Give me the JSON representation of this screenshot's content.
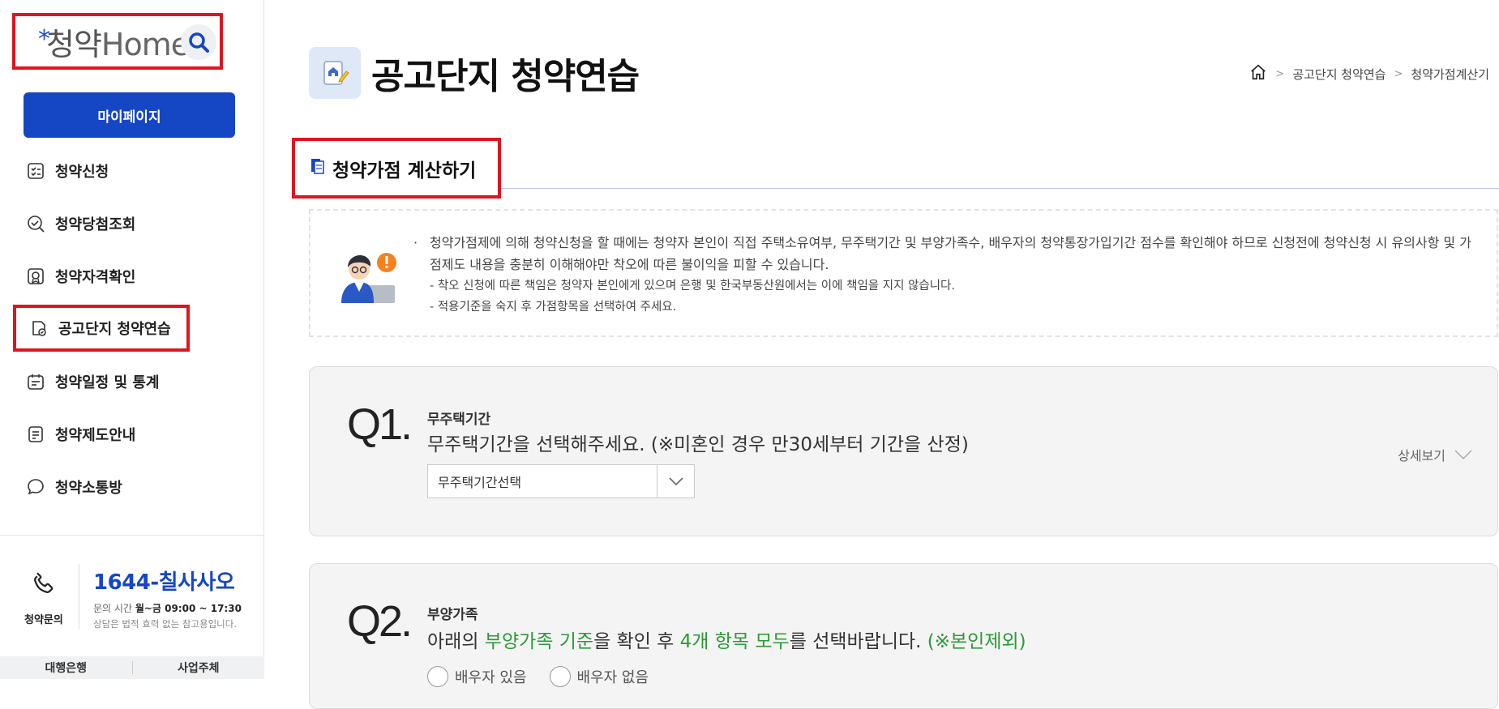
{
  "sidebar": {
    "logo_star": "*",
    "logo_text_ko": "청약",
    "logo_text_en": "Home",
    "mypage_label": "마이페이지",
    "items": [
      {
        "label": "청약신청",
        "icon": "checklist-icon"
      },
      {
        "label": "청약당첨조회",
        "icon": "search-check-icon"
      },
      {
        "label": "청약자격확인",
        "icon": "certificate-icon"
      },
      {
        "label": "공고단지 청약연습",
        "icon": "practice-icon"
      },
      {
        "label": "청약일정 및 통계",
        "icon": "calendar-icon"
      },
      {
        "label": "청약제도안내",
        "icon": "document-icon"
      },
      {
        "label": "청약소통방",
        "icon": "chat-bubble-icon"
      }
    ],
    "contact": {
      "label": "청약문의",
      "number": "1644-칠사사오",
      "hours_prefix": "문의 시간",
      "hours_value": "월~금 09:00 ~ 17:30",
      "note": "상담은 법적 효력 없는 참고용입니다."
    },
    "tabs": [
      "대행은행",
      "사업주체"
    ]
  },
  "header": {
    "title": "공고단지 청약연습",
    "breadcrumb": [
      "공고단지 청약연습",
      "청약가점계산기"
    ]
  },
  "section": {
    "title": "청약가점 계산하기"
  },
  "notice": {
    "main": "청약가점제에 의해 청약신청을 할 때에는 청약자 본인이 직접 주택소유여부, 무주택기간 및 부양가족수, 배우자의 청약통장가입기간 점수를 확인해야 하므로 신청전에 청약신청 시 유의사항 및 가점제도 내용을 충분히 이해해야만 착오에 따른 불이익을 피할 수 있습니다.",
    "sub1": "- 착오 신청에 따른 책임은 청약자 본인에게 있으며 은행 및 한국부동산원에서는 이에 책임을 지지 않습니다.",
    "sub2": "- 적용기준을 숙지 후 가점항목을 선택하여 주세요."
  },
  "q1": {
    "number": "Q1.",
    "tag": "무주택기간",
    "question": "무주택기간을 선택해주세요. (※미혼인 경우 만30세부터 기간을 산정)",
    "select_value": "무주택기간선택",
    "detail_label": "상세보기"
  },
  "q2": {
    "number": "Q2.",
    "tag": "부양가족",
    "q_part1": "아래의 ",
    "q_part2": "부양가족 기준",
    "q_part3": "을 확인 후 ",
    "q_part4": "4개 항목 모두",
    "q_part5": "를 선택바랍니다. ",
    "q_part6": "(※본인제외)",
    "radio1": "배우자 있음",
    "radio2": "배우자 없음"
  },
  "colors": {
    "accent_blue": "#1547c4",
    "highlight_red": "#e0141e",
    "green_text": "#2b9a37"
  }
}
